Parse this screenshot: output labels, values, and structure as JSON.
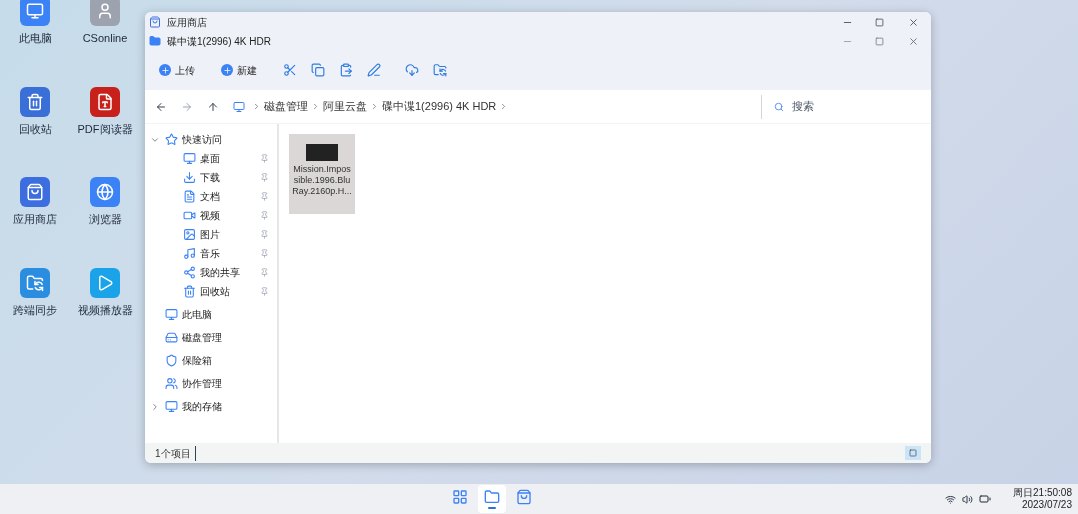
{
  "desktop_icons": [
    {
      "label": "此电脑",
      "kind": "pc"
    },
    {
      "label": "CSonline",
      "kind": "game"
    },
    {
      "label": "回收站",
      "kind": "bin"
    },
    {
      "label": "PDF阅读器",
      "kind": "pdf"
    },
    {
      "label": "应用商店",
      "kind": "store"
    },
    {
      "label": "浏览器",
      "kind": "browser"
    },
    {
      "label": "跨端同步",
      "kind": "sync"
    },
    {
      "label": "视频播放器",
      "kind": "player"
    }
  ],
  "window": {
    "title": "应用商店",
    "tab_title": "碟中谍1(2996) 4K HDR"
  },
  "toolbar": {
    "buttons": [
      {
        "label": "上传"
      },
      {
        "label": "新建"
      }
    ]
  },
  "address_bar": {
    "crumbs": [
      "磁盘管理",
      "阿里云盘",
      "碟中谍1(2996) 4K HDR"
    ],
    "search": {
      "placeholder": "搜索"
    }
  },
  "sidebar": {
    "items": [
      {
        "label": "快速访问",
        "kind": "star",
        "expanded": true,
        "children": [
          {
            "label": "桌面",
            "kind": "desktop",
            "pinned": true
          },
          {
            "label": "下载",
            "kind": "download",
            "pinned": true
          },
          {
            "label": "文档",
            "kind": "doc",
            "pinned": true
          },
          {
            "label": "视频",
            "kind": "video",
            "pinned": true
          },
          {
            "label": "图片",
            "kind": "image",
            "pinned": true
          },
          {
            "label": "音乐",
            "kind": "music",
            "pinned": true
          },
          {
            "label": "我的共享",
            "kind": "share",
            "pinned": true
          },
          {
            "label": "回收站",
            "kind": "bin",
            "pinned": true
          }
        ]
      },
      {
        "label": "此电脑",
        "kind": "pc"
      },
      {
        "label": "磁盘管理",
        "kind": "disk"
      },
      {
        "label": "保险箱",
        "kind": "safe"
      },
      {
        "label": "协作管理",
        "kind": "collab"
      },
      {
        "label": "我的存储",
        "kind": "pc",
        "expanded": false
      }
    ]
  },
  "files": [
    {
      "name_lines": [
        "Mission.Impos",
        "sible.1996.Blu",
        "Ray.2160p.H..."
      ],
      "selected": true
    }
  ],
  "status_bar": {
    "count": "1个项目"
  },
  "taskbar": {
    "apps": [
      {
        "kind": "start",
        "selected": false
      },
      {
        "kind": "files",
        "selected": true
      },
      {
        "kind": "store",
        "selected": false
      }
    ],
    "time": "周日21:50:08",
    "date": "2023/07/23"
  }
}
